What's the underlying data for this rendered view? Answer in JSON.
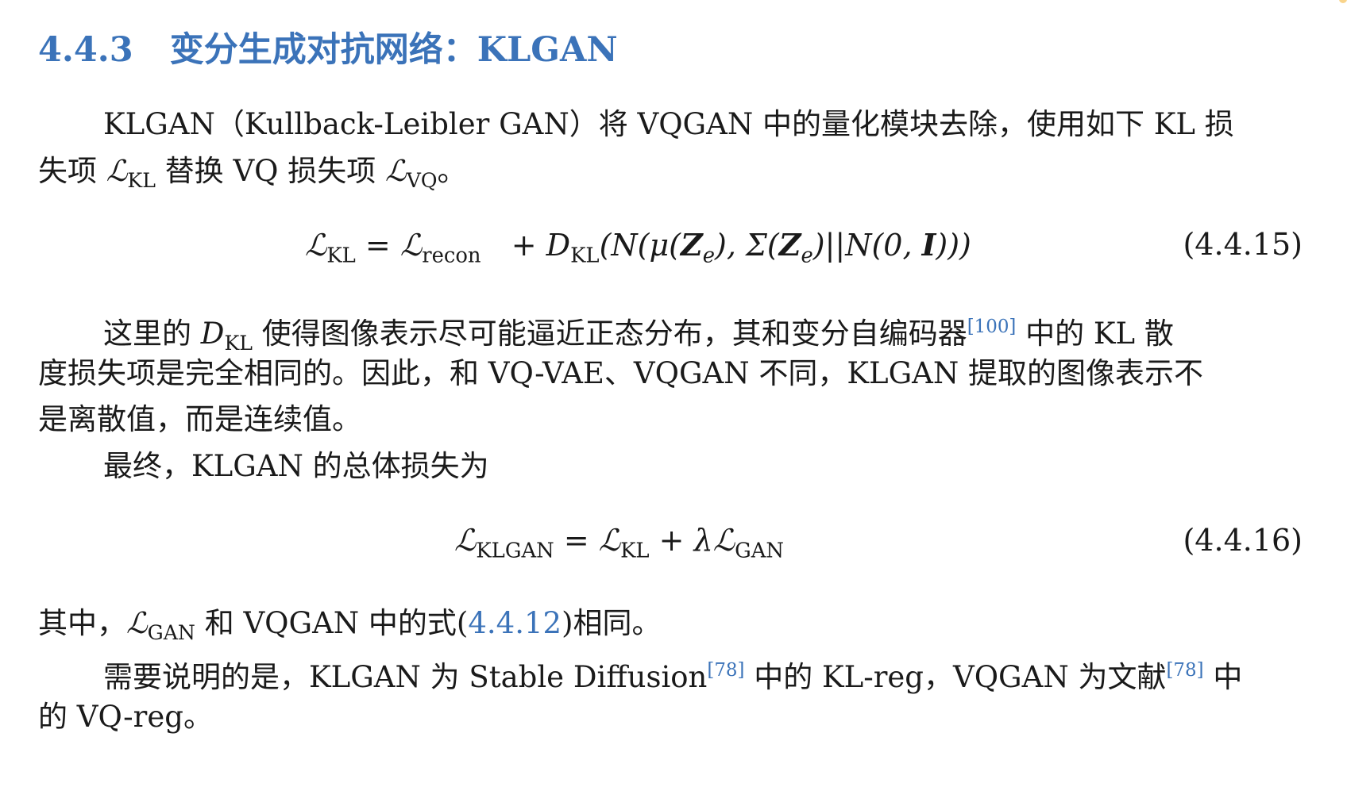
{
  "section": {
    "number": "4.4.3",
    "title": "变分生成对抗网络：KLGAN"
  },
  "paragraph1": {
    "line1": "KLGAN（Kullback-Leibler GAN）将 VQGAN 中的量化模块去除，使用如下 KL 损",
    "line2_a": "失项 ",
    "line2_b": " 替换 VQ 损失项 ",
    "line2_c": "。"
  },
  "symbols": {
    "script_L": "ℒ",
    "sub_KL": "KL",
    "sub_VQ": "VQ",
    "sub_recon": "recon",
    "sub_KLGAN": "KLGAN",
    "sub_GAN": "GAN",
    "D": "D",
    "lambda": "λ",
    "equals": "=",
    "plus": "+"
  },
  "equation1": {
    "rhs_tail_1": "(N(μ(",
    "Z": "Z",
    "sub_e": "e",
    "rhs_tail_2": "), Σ(",
    "rhs_tail_3": ")||N(0, ",
    "I": "I",
    "rhs_tail_4": ")))",
    "number": "(4.4.15)"
  },
  "paragraph2": {
    "line1_a": "这里的 ",
    "line1_b": " 使得图像表示尽可能逼近正态分布，其和变分自编码器",
    "cite": "[100]",
    "line1_c": " 中的 KL 散",
    "line2": "度损失项是完全相同的。因此，和 VQ-VAE、VQGAN 不同，KLGAN 提取的图像表示不",
    "line3": "是离散值，而是连续值。"
  },
  "paragraph3": {
    "text": "最终，KLGAN 的总体损失为"
  },
  "equation2": {
    "number": "(4.4.16)"
  },
  "paragraph4": {
    "a": "其中，",
    "b": " 和 VQGAN 中的式(",
    "ref": "4.4.12",
    "c": ")相同。"
  },
  "paragraph5": {
    "line1_a": "需要说明的是，KLGAN 为 Stable Diffusion",
    "cite1": "[78]",
    "line1_b": " 中的 KL-reg，VQGAN 为文献",
    "cite2": "[78]",
    "line1_c": " 中",
    "line2": "的 VQ-reg。"
  }
}
